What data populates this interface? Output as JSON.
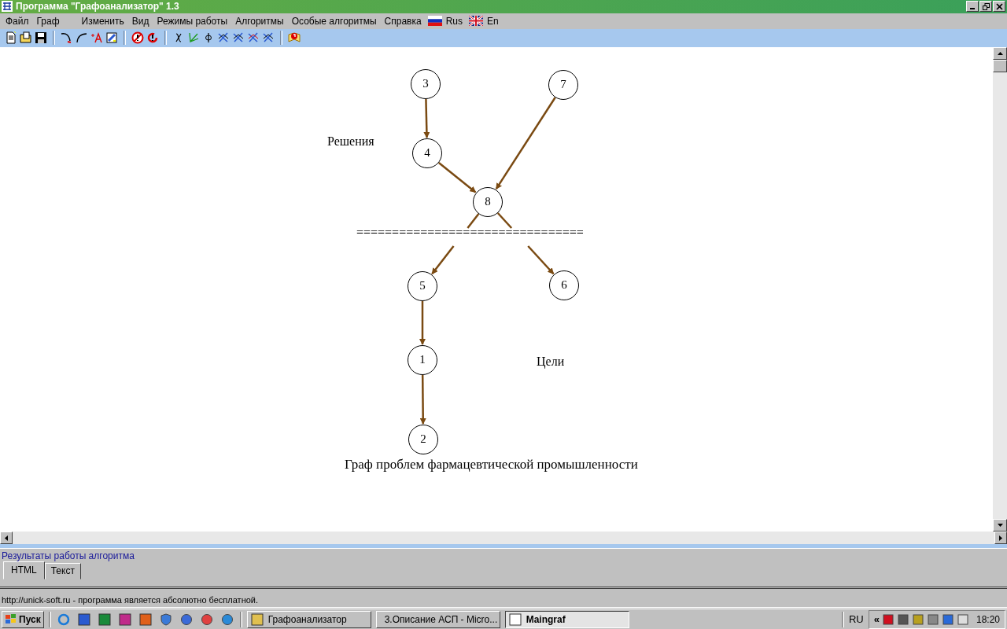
{
  "window": {
    "title": "Программа \"Графоанализатор\" 1.3"
  },
  "menu": [
    {
      "label": "Файл"
    },
    {
      "label": "Граф"
    },
    {
      "label": "Изменить"
    },
    {
      "label": "Вид"
    },
    {
      "label": "Режимы работы"
    },
    {
      "label": "Алгоритмы"
    },
    {
      "label": "Особые алгоритмы"
    },
    {
      "label": "Справка"
    }
  ],
  "languages": [
    {
      "label": "Rus"
    },
    {
      "label": "En"
    }
  ],
  "graph": {
    "nodes": [
      {
        "label": "3"
      },
      {
        "label": "7"
      },
      {
        "label": "4"
      },
      {
        "label": "8"
      },
      {
        "label": "5"
      },
      {
        "label": "6"
      },
      {
        "label": "1"
      },
      {
        "label": "2"
      }
    ],
    "labels": [
      "Решения",
      "================================",
      "Цели",
      "Граф проблем фармацевтической промышленности"
    ]
  },
  "results": {
    "title": "Результаты работы алгоритма",
    "tabs": [
      {
        "label": "HTML",
        "selected": true
      },
      {
        "label": "Текст",
        "selected": false
      }
    ]
  },
  "status_bar": "http://unick-soft.ru -  программа является абсолютно бесплатной.",
  "taskbar": {
    "start": "Пуск",
    "tasks": [
      {
        "label": "Графоанализатор",
        "selected": false
      },
      {
        "label": "3.Описание АСП - Micro...",
        "selected": false
      },
      {
        "label": "Maingraf",
        "selected": true
      }
    ],
    "language": "RU",
    "expand": "«",
    "clock": "18:20"
  }
}
